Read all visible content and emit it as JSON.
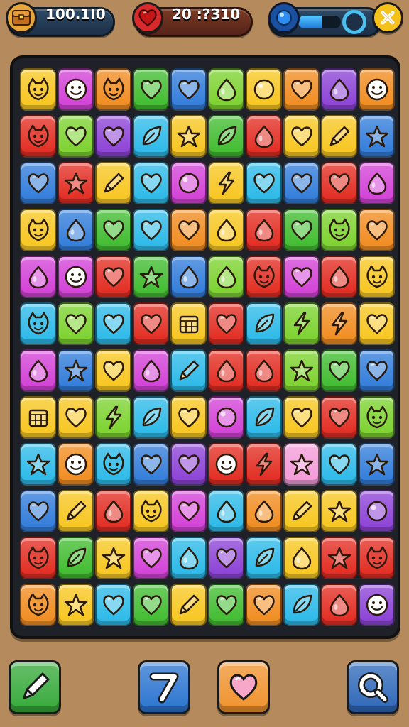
{
  "hud": {
    "coins": {
      "icon": "treasure-chest-icon",
      "value": "100.1I0"
    },
    "lives": {
      "icon": "heart-gem-icon",
      "value": "20 :?310"
    },
    "boost": {
      "icon": "blue-orb-icon",
      "progress": 0.55
    },
    "close": {
      "icon": "close-icon"
    }
  },
  "colors": {
    "Y": "#f7c51c",
    "P": "#d23ed6",
    "O": "#f08a1c",
    "G": "#3dbb2c",
    "B": "#2e7ad9",
    "L": "#7ad12b",
    "R": "#e2281e",
    "C": "#28b8e8",
    "V": "#8a3fd6",
    "K": "#f39ad8"
  },
  "board": {
    "rows": [
      [
        "Y:face",
        "P:smile",
        "O:face",
        "G:heart",
        "B:heart",
        "L:drop",
        "Y:dot",
        "O:heart",
        "V:drop",
        "O:smile"
      ],
      [
        "R:face",
        "L:heart",
        "V:heart",
        "C:leaf",
        "Y:star",
        "G:leaf",
        "R:drop",
        "Y:heart",
        "Y:pencil",
        "B:star"
      ],
      [
        "B:heart",
        "R:star",
        "Y:pencil",
        "C:heart",
        "P:dot",
        "Y:bolt",
        "C:heart",
        "B:heart",
        "R:heart",
        "P:drop"
      ],
      [
        "Y:face",
        "B:drop",
        "G:heart",
        "C:heart",
        "O:heart",
        "Y:drop",
        "R:drop",
        "G:heart",
        "L:face",
        "O:heart"
      ],
      [
        "P:drop",
        "P:smile",
        "R:heart",
        "G:star",
        "B:drop",
        "L:drop",
        "R:face",
        "P:heart",
        "R:drop",
        "Y:face"
      ],
      [
        "C:face",
        "L:heart",
        "C:heart",
        "R:heart",
        "Y:box",
        "R:heart",
        "C:leaf",
        "L:bolt",
        "O:bolt",
        "Y:heart"
      ],
      [
        "P:drop",
        "B:star",
        "Y:heart",
        "P:drop",
        "C:pencil",
        "R:drop",
        "R:drop",
        "L:star",
        "G:heart",
        "B:heart"
      ],
      [
        "Y:box",
        "Y:heart",
        "L:bolt",
        "C:leaf",
        "Y:heart",
        "P:dot",
        "C:leaf",
        "Y:heart",
        "R:heart",
        "L:face"
      ],
      [
        "C:star",
        "O:smile",
        "C:face",
        "B:heart",
        "V:heart",
        "R:smile",
        "R:bolt",
        "K:star",
        "C:heart",
        "B:star"
      ],
      [
        "B:heart",
        "Y:pencil",
        "R:drop",
        "Y:face",
        "P:heart",
        "C:drop",
        "O:drop",
        "Y:pencil",
        "Y:star",
        "V:dot"
      ],
      [
        "R:face",
        "G:leaf",
        "Y:star",
        "P:heart",
        "C:drop",
        "V:heart",
        "C:leaf",
        "Y:drop",
        "R:star",
        "R:face"
      ],
      [
        "O:face",
        "Y:star",
        "C:heart",
        "G:heart",
        "Y:pencil",
        "G:heart",
        "O:heart",
        "C:leaf",
        "R:drop",
        "V:smile"
      ]
    ]
  },
  "buttons": [
    {
      "name": "pencil-button",
      "icon": "pencil-icon",
      "color": "#36a93a"
    },
    {
      "name": "seven-button",
      "icon": "seven-icon",
      "color": "#2b74d0"
    },
    {
      "name": "heart-button",
      "icon": "heart-icon",
      "color": "#f0922c"
    },
    {
      "name": "search-button",
      "icon": "search-icon",
      "color": "#2e67b8"
    }
  ]
}
